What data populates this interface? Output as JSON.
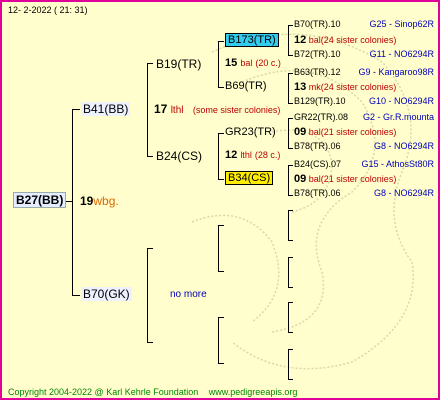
{
  "header": {
    "date": "12-  2-2022 ( 21: 31)"
  },
  "colors": {
    "border": "#e0009a",
    "background": "#fffecc",
    "highlight_cyan": "#33ccee",
    "highlight_yellow": "#ffee00",
    "id_blue": "#0000bb",
    "info_red": "#bb0000",
    "footer_green": "#008800"
  },
  "root": {
    "id": "B27(BB)",
    "num": "19",
    "code": "wbg",
    "suffix": "."
  },
  "gen2": {
    "mother": {
      "id": "B41(BB)",
      "num": "17",
      "code": "lthl",
      "note": "(some sister colonies)"
    },
    "father": {
      "id": "B70(GK)",
      "note": "no more"
    }
  },
  "gen3": {
    "mm": {
      "id": "B19(TR)"
    },
    "mf": {
      "id": "B24(CS)"
    }
  },
  "gen4": {
    "a": {
      "id": "B173(TR)",
      "num": "15",
      "code": "bal",
      "note": "(20 c.)"
    },
    "b": {
      "id": "B69(TR)"
    },
    "c": {
      "id": "GR23(TR)",
      "num": "12",
      "code": "lthl",
      "note": "(28 c.)"
    },
    "d": {
      "id": "B34(CS)"
    }
  },
  "gen5": [
    {
      "id": "B70(TR).10",
      "info": "G25 - Sinop62R"
    },
    {
      "num": "12",
      "code": "bal",
      "note": "(24 sister colonies)"
    },
    {
      "id": "B72(TR).10",
      "info": "G11 - NO6294R"
    },
    {
      "id": "B63(TR).12",
      "info": "G9 - Kangaroo98R"
    },
    {
      "num": "13",
      "code": "mk",
      "note": "(24 sister colonies)"
    },
    {
      "id": "B129(TR).10",
      "info": "G10 - NO6294R"
    },
    {
      "id": "GR22(TR).08",
      "info": "G2 - Gr.R.mounta"
    },
    {
      "num": "09",
      "code": "bal",
      "note": "(21 sister colonies)"
    },
    {
      "id": "B78(TR).06",
      "info": "G8 - NO6294R"
    },
    {
      "id": "B24(CS).07",
      "info": "G15 - AthosSt80R"
    },
    {
      "num": "09",
      "code": "bal",
      "note": "(21 sister colonies)"
    },
    {
      "id": "B78(TR).06",
      "info": "G8 - NO6294R"
    }
  ],
  "footer": {
    "copyright": "Copyright 2004-2022 @ Karl Kehrle Foundation",
    "url": "www.pedigreeapis.org"
  }
}
